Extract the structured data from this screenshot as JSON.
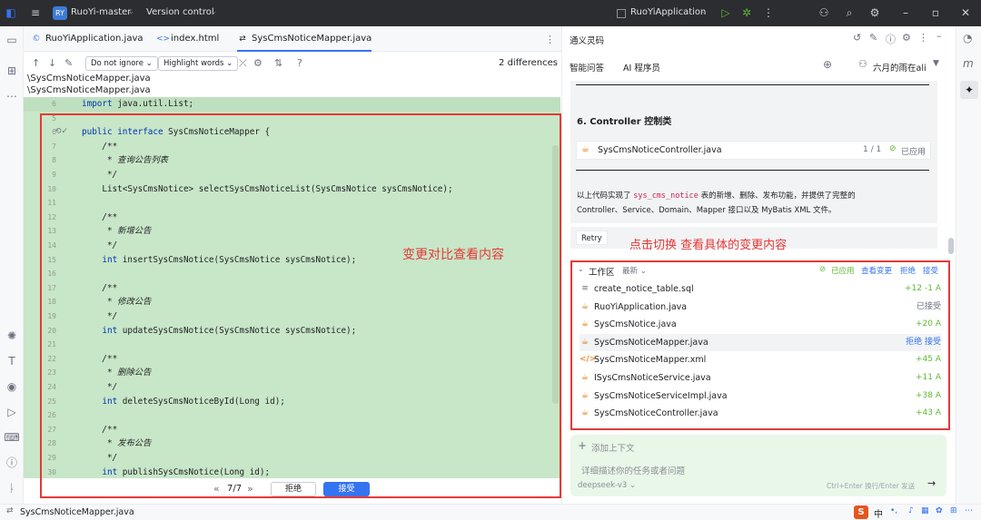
{
  "titlebar": {
    "project_badge": "RY",
    "project": "RuoYi-master",
    "vcs": "Version control",
    "run_config": "RuoYiApplication"
  },
  "tabs": [
    {
      "label": "RuoYiApplication.java",
      "icon": "java-class-icon"
    },
    {
      "label": "index.html",
      "icon": "html-tag-icon"
    },
    {
      "label": "SysCmsNoticeMapper.java",
      "icon": "diff-icon"
    }
  ],
  "diff_toolbar": {
    "ignore": "Do not ignore",
    "highlight": "Highlight words",
    "differences": "2 differences"
  },
  "paths": [
    "\\SysCmsNoticeMapper.java",
    "\\SysCmsNoticeMapper.java"
  ],
  "code_lines": [
    {
      "n": "6",
      "code": "import java.util.List;"
    },
    {
      "n": "5",
      "code": ""
    },
    {
      "n": "6",
      "code": "public interface SysCmsNoticeMapper {"
    },
    {
      "n": "7",
      "code": "    /**"
    },
    {
      "n": "8",
      "code": "     * 查询公告列表"
    },
    {
      "n": "9",
      "code": "     */"
    },
    {
      "n": "10",
      "code": "    List<SysCmsNotice> selectSysCmsNoticeList(SysCmsNotice sysCmsNotice);"
    },
    {
      "n": "11",
      "code": ""
    },
    {
      "n": "12",
      "code": "    /**"
    },
    {
      "n": "13",
      "code": "     * 新增公告"
    },
    {
      "n": "14",
      "code": "     */"
    },
    {
      "n": "15",
      "code": "    int insertSysCmsNotice(SysCmsNotice sysCmsNotice);"
    },
    {
      "n": "16",
      "code": ""
    },
    {
      "n": "17",
      "code": "    /**"
    },
    {
      "n": "18",
      "code": "     * 修改公告"
    },
    {
      "n": "19",
      "code": "     */"
    },
    {
      "n": "20",
      "code": "    int updateSysCmsNotice(SysCmsNotice sysCmsNotice);"
    },
    {
      "n": "21",
      "code": ""
    },
    {
      "n": "22",
      "code": "    /**"
    },
    {
      "n": "23",
      "code": "     * 删除公告"
    },
    {
      "n": "24",
      "code": "     */"
    },
    {
      "n": "25",
      "code": "    int deleteSysCmsNoticeById(Long id);"
    },
    {
      "n": "26",
      "code": ""
    },
    {
      "n": "27",
      "code": "    /**"
    },
    {
      "n": "28",
      "code": "     * 发布公告"
    },
    {
      "n": "29",
      "code": "     */"
    },
    {
      "n": "30",
      "code": "    int publishSysCmsNotice(Long id);"
    }
  ],
  "code_note": "变更对比查看内容",
  "diff_nav": {
    "counter": "7/7",
    "reject": "拒绝",
    "accept": "接受"
  },
  "right_panel": {
    "title": "通义灵码",
    "tab_qa": "智能问答",
    "tab_ai": "AI 程序员",
    "user": "六月的雨在ali",
    "section_heading": "6. Controller 控制类",
    "file_card": {
      "name": "SysCmsNoticeController.java",
      "count": "1 / 1",
      "status": "已应用"
    },
    "summary_1": "以上代码实现了",
    "summary_code": "sys_cms_notice",
    "summary_2": "表的新增、删除、发布功能，并提供了完整的",
    "summary_line2": "Controller、Service、Domain、Mapper 接口以及 MyBatis XML 文件。",
    "retry": "Retry",
    "note": "点击切换 查看具体的变更内容"
  },
  "workspace": {
    "title": "工作区",
    "latest": "最新",
    "applied": "已应用",
    "view_changes": "查看变更",
    "reject": "拒绝",
    "accept": "接受",
    "files": [
      {
        "name": "create_notice_table.sql",
        "status": "+12 -1  A",
        "icon": "sql-file-icon"
      },
      {
        "name": "RuoYiApplication.java",
        "status": "已接受",
        "icon": "java-file-icon"
      },
      {
        "name": "SysCmsNotice.java",
        "status": "+20  A",
        "icon": "java-file-icon"
      },
      {
        "name": "SysCmsNoticeMapper.java",
        "status": "拒绝  接受",
        "icon": "java-file-icon"
      },
      {
        "name": "SysCmsNoticeMapper.xml",
        "status": "+45  A",
        "icon": "xml-file-icon"
      },
      {
        "name": "ISysCmsNoticeService.java",
        "status": "+11  A",
        "icon": "java-file-icon"
      },
      {
        "name": "SysCmsNoticeServiceImpl.java",
        "status": "+38  A",
        "icon": "java-file-icon"
      },
      {
        "name": "SysCmsNoticeController.java",
        "status": "+43  A",
        "icon": "java-file-icon"
      }
    ]
  },
  "input": {
    "add_context": "添加上下文",
    "placeholder": "详细描述你的任务或者问题",
    "model": "deepseek-v3",
    "hint": "Ctrl+Enter 换行/Enter 发送"
  },
  "statusbar": {
    "file": "SysCmsNoticeMapper.java",
    "ime": "中"
  }
}
